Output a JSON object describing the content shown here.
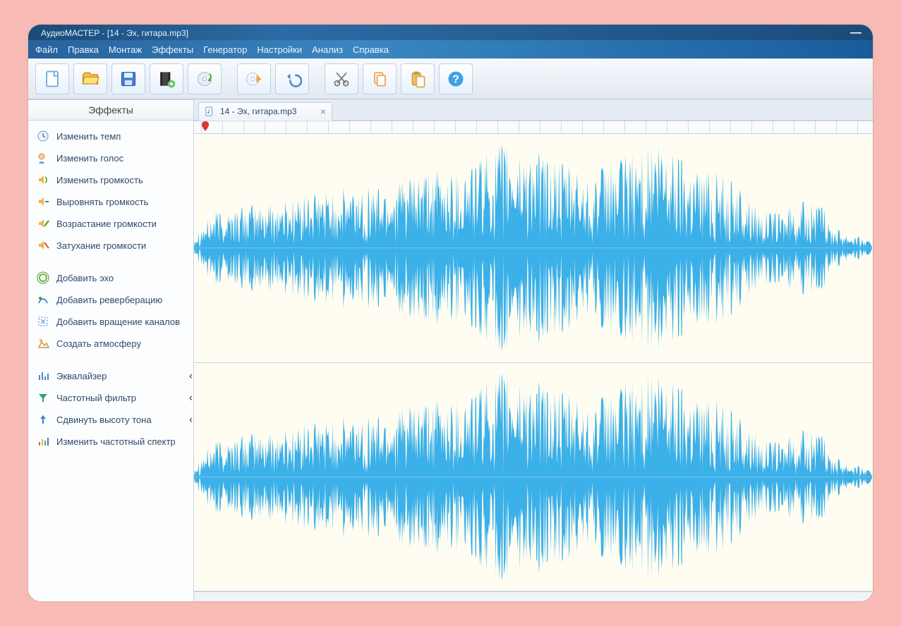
{
  "window": {
    "title": "АудиоМАСТЕР - [14 - Эх, гитара.mp3]"
  },
  "menu": {
    "items": [
      "Файл",
      "Правка",
      "Монтаж",
      "Эффекты",
      "Генератор",
      "Настройки",
      "Анализ",
      "Справка"
    ]
  },
  "toolbar": {
    "buttons": [
      {
        "name": "new-file-button",
        "icon": "file-new"
      },
      {
        "name": "open-file-button",
        "icon": "file-open"
      },
      {
        "name": "save-file-button",
        "icon": "file-save"
      },
      {
        "name": "import-video-button",
        "icon": "film-add"
      },
      {
        "name": "burn-disc-button",
        "icon": "disc-music"
      },
      {
        "sep": true
      },
      {
        "name": "extract-audio-button",
        "icon": "disc-arrow"
      },
      {
        "name": "undo-button",
        "icon": "undo"
      },
      {
        "sep": true
      },
      {
        "name": "cut-button",
        "icon": "scissors"
      },
      {
        "name": "copy-button",
        "icon": "copy"
      },
      {
        "name": "paste-button",
        "icon": "paste"
      },
      {
        "name": "help-button",
        "icon": "help"
      }
    ]
  },
  "sidebar": {
    "title": "Эффекты",
    "groups": [
      [
        {
          "icon": "clock",
          "label": "Изменить темп"
        },
        {
          "icon": "voice",
          "label": "Изменить голос"
        },
        {
          "icon": "vol-change",
          "label": "Изменить громкость"
        },
        {
          "icon": "vol-normalize",
          "label": "Выровнять громкость"
        },
        {
          "icon": "vol-fadein",
          "label": "Возрастание громкости"
        },
        {
          "icon": "vol-fadeout",
          "label": "Затухание громкости"
        }
      ],
      [
        {
          "icon": "echo",
          "label": "Добавить эхо"
        },
        {
          "icon": "reverb",
          "label": "Добавить реверберацию"
        },
        {
          "icon": "rotate-channels",
          "label": "Добавить вращение каналов"
        },
        {
          "icon": "atmosphere",
          "label": "Создать атмосферу"
        }
      ],
      [
        {
          "icon": "equalizer",
          "label": "Эквалайзер",
          "chev": true
        },
        {
          "icon": "funnel",
          "label": "Частотный фильтр",
          "chev": true
        },
        {
          "icon": "pitch",
          "label": "Сдвинуть высоту тона",
          "chev": true
        },
        {
          "icon": "spectrum",
          "label": "Изменить частотный спектр"
        }
      ]
    ]
  },
  "tabs": [
    {
      "label": "14 - Эх, гитара.mp3"
    }
  ],
  "colors": {
    "wave": "#3cb0e8",
    "pane_bg": "#fffdf2"
  }
}
